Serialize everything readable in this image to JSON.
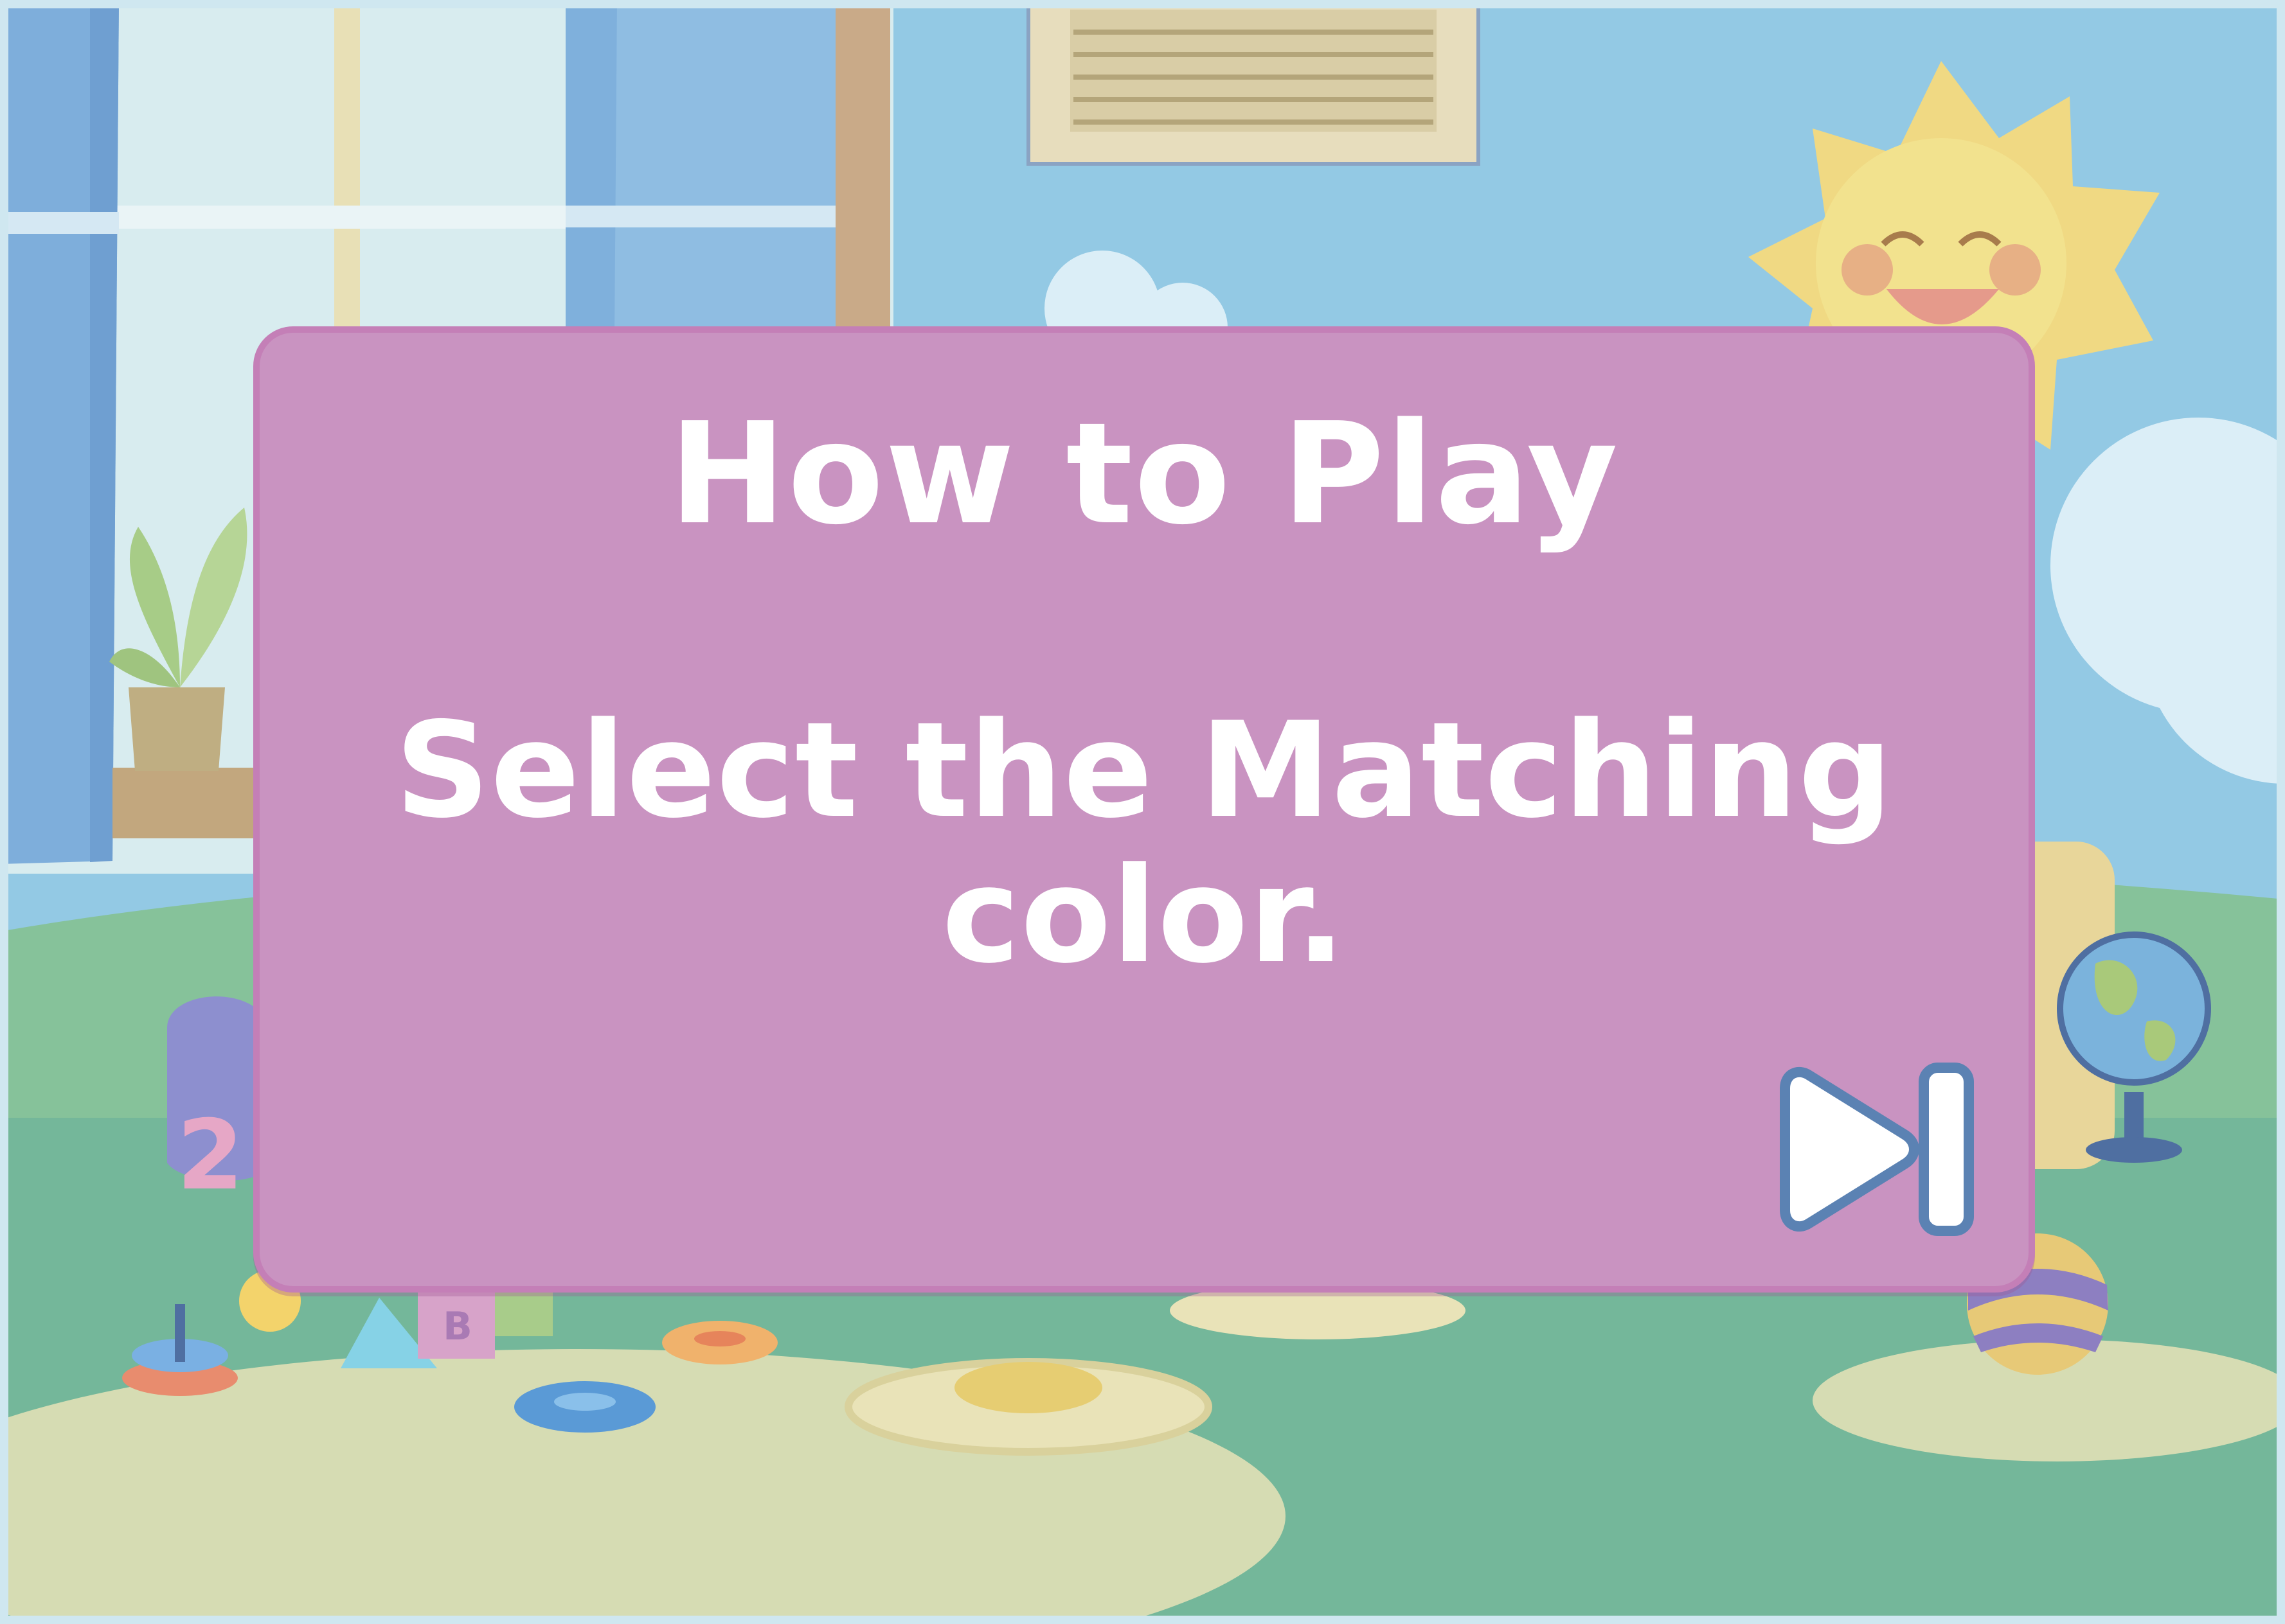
{
  "game": {
    "screen": "instructions"
  },
  "dialog": {
    "title": "How to Play",
    "instruction": "Select the Matching color.",
    "skip_icon": "skip-next-icon"
  },
  "scene": {
    "setting": "playroom",
    "decorations": [
      "window-icon",
      "curtain-icon",
      "air-vent-icon",
      "sun-icon",
      "cloud-icon",
      "plant-icon",
      "globe-icon",
      "ball-icon",
      "ring-toy-icon",
      "stacking-toy-icon",
      "number-toy-icon",
      "letter-block-icon",
      "cone-toy-icon",
      "rug-icon"
    ]
  },
  "colors": {
    "dialog_fill": "#c993c1",
    "dialog_border": "#c47fb7",
    "text": "#ffffff",
    "sky": "#93c9e4",
    "floor": "#74b79a",
    "rug": "#d6dcb3"
  }
}
